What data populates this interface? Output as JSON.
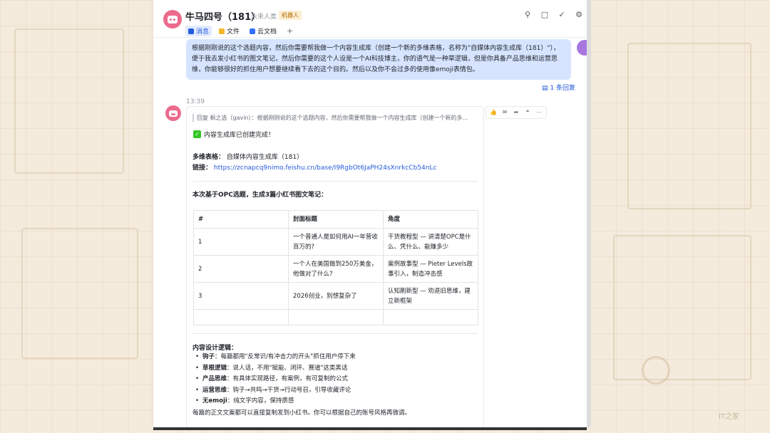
{
  "header": {
    "title": "牛马四号（181）",
    "subtitle": "未来人类",
    "badge": "机器人"
  },
  "tabs": [
    {
      "label": "消息",
      "active": true,
      "icon": "chat-icon"
    },
    {
      "label": "文件",
      "active": false,
      "icon": "folder-icon"
    },
    {
      "label": "云文档",
      "active": false,
      "icon": "doc-icon"
    }
  ],
  "user_message": {
    "text": "根据刚刚说的这个选题内容，然后你需要帮我做一个内容生成库（创建一个新的多维表格，名称为\"自媒体内容生成库（181）\"），便于我去发小红书的图文笔记，然后你需要的这个人设是一个AI科技博主，你的语气是一种草逻辑，但是你具备产品思维和运营思维，你能够很好的抓住用户想要继续看下去的这个目的。然后以及你不会过多的使用像emoji表情包。",
    "reply_count": "1 条回复"
  },
  "timestamp": "13:39",
  "bot_message": {
    "quote": "回复 枫之选（gavin）：根据刚刚说的这个选题内容，然后你需要帮我做一个内容生成库（创建一个新的多...",
    "done": "内容生成库已创建完成！",
    "table_label": "多维表格：",
    "table_value": "自媒体内容生成库（181）",
    "link_label": "链接：",
    "link_value": "https://zcnapcq9nimo.feishu.cn/base/I9RgbOt6JaPH24sXnrkcCb54nLc",
    "section_title": "本次基于OPC选题，生成3篇小红书图文笔记：",
    "table": {
      "headers": [
        "#",
        "封面标题",
        "角度"
      ],
      "rows": [
        [
          "1",
          "一个普通人是如何用AI一年营收百万的?",
          "干货教程型 — 讲清楚OPC是什么、凭什么、能赚多少"
        ],
        [
          "2",
          "一个人在美国做到250万美金，他做对了什么?",
          "案例故事型 — Pieter Levels故事引入，制造冲击感"
        ],
        [
          "3",
          "2026创业，别想复杂了",
          "认知刷新型 — 劝退旧思维，建立新框架"
        ],
        [
          "",
          "",
          ""
        ]
      ]
    },
    "logic_title": "内容设计逻辑：",
    "logic_items": [
      {
        "key": "钩子",
        "text": "：每篇都用\"反常识/有冲击力的开头\"抓住用户停下来"
      },
      {
        "key": "草根逻辑",
        "text": "：说人话，不用\"赋能、闭环、赛道\"这类黑话"
      },
      {
        "key": "产品思维",
        "text": "：有具体实现路径，有案例，有可复制的公式"
      },
      {
        "key": "运营思维",
        "text": "：钩子→共鸣→干货→行动号召，引导收藏评论"
      },
      {
        "key": "无emoji",
        "text": "：纯文字内容，保持质感"
      }
    ],
    "footnote": "每篇的正文文案都可以直接复制发到小红书。你可以根据自己的账号风格再微调。"
  },
  "watermark": "IT之家",
  "colors": {
    "accent": "#245bdb",
    "bubble": "#d6e4ff",
    "bot_avatar": "#ec6a8c",
    "background": "#f4ebdd"
  }
}
